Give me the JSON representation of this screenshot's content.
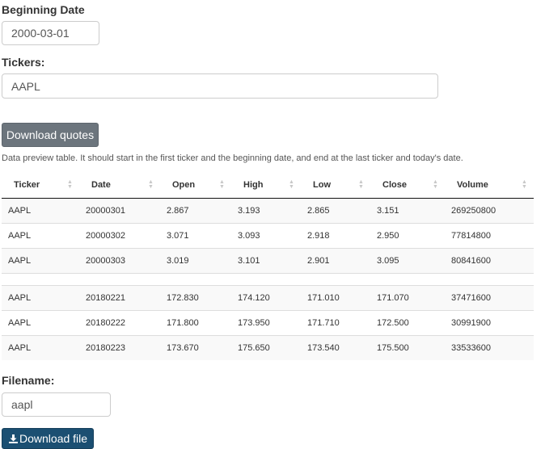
{
  "date": {
    "label": "Beginning Date",
    "value": "2000-03-01"
  },
  "tickers": {
    "label": "Tickers:",
    "value": "AAPL"
  },
  "download_quotes": {
    "label": "Download quotes"
  },
  "preview_note": "Data preview table. It should start in the first ticker and the beginning date, and end at the last ticker and today's date.",
  "table": {
    "columns": [
      "Ticker",
      "Date",
      "Open",
      "High",
      "Low",
      "Close",
      "Volume"
    ],
    "rows_top": [
      [
        "AAPL",
        "20000301",
        "2.867",
        "3.193",
        "2.865",
        "3.151",
        "269250800"
      ],
      [
        "AAPL",
        "20000302",
        "3.071",
        "3.093",
        "2.918",
        "2.950",
        "77814800"
      ],
      [
        "AAPL",
        "20000303",
        "3.019",
        "3.101",
        "2.901",
        "3.095",
        "80841600"
      ]
    ],
    "rows_bottom": [
      [
        "AAPL",
        "20180221",
        "172.830",
        "174.120",
        "171.010",
        "171.070",
        "37471600"
      ],
      [
        "AAPL",
        "20180222",
        "171.800",
        "173.950",
        "171.710",
        "172.500",
        "30991900"
      ],
      [
        "AAPL",
        "20180223",
        "173.670",
        "175.650",
        "173.540",
        "175.500",
        "33533600"
      ]
    ]
  },
  "filename": {
    "label": "Filename:",
    "value": "aapl"
  },
  "download_file": {
    "label": "Download file",
    "icon": "download-icon"
  }
}
